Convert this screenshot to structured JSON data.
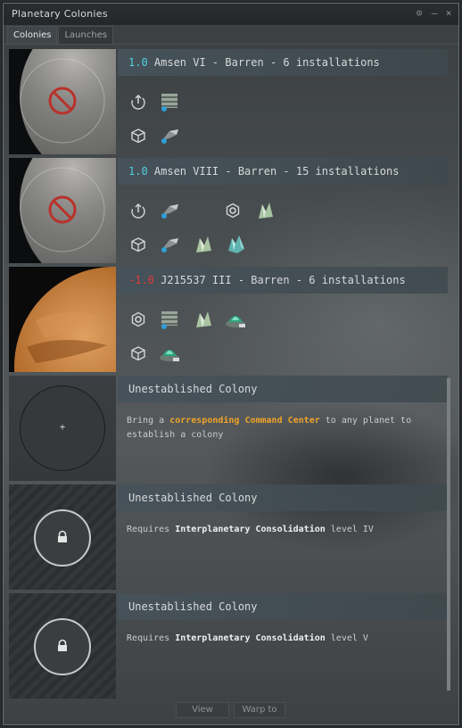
{
  "window": {
    "title": "Planetary Colonies"
  },
  "tabs": [
    {
      "label": "Colonies",
      "active": true
    },
    {
      "label": "Launches",
      "active": false
    }
  ],
  "colonies": [
    {
      "security": "1.0",
      "name": " Amsen VI - Barren - 6 installations",
      "security_color": "#4fd0e0"
    },
    {
      "security": "1.0",
      "name": " Amsen VIII - Barren - 15 installations",
      "security_color": "#4fd0e0"
    },
    {
      "security": "-1.0",
      "name": " J215537 III - Barren - 6 installations",
      "security_color": "#e03b3b"
    }
  ],
  "unestablished": [
    {
      "title": "Unestablished Colony",
      "text_prefix": "Bring a ",
      "link": "corresponding Command Center",
      "text_suffix": " to any planet to establish a colony",
      "thumb_symbol": "+"
    },
    {
      "title": "Unestablished Colony",
      "text_prefix": "Requires ",
      "skill": "Interplanetary Consolidation",
      "text_suffix": " level IV"
    },
    {
      "title": "Unestablished Colony",
      "text_prefix": "Requires ",
      "skill": "Interplanetary Consolidation",
      "text_suffix": " level V"
    }
  ],
  "buttons": {
    "view": "View",
    "warp": "Warp to"
  },
  "colors": {
    "accent_link": "#f0a32a",
    "security_high": "#4fd0e0",
    "security_low": "#e03b3b"
  },
  "icons": [
    "export-icon",
    "storage-icon",
    "factory-icon",
    "lock-icon",
    "no-entry-icon"
  ]
}
